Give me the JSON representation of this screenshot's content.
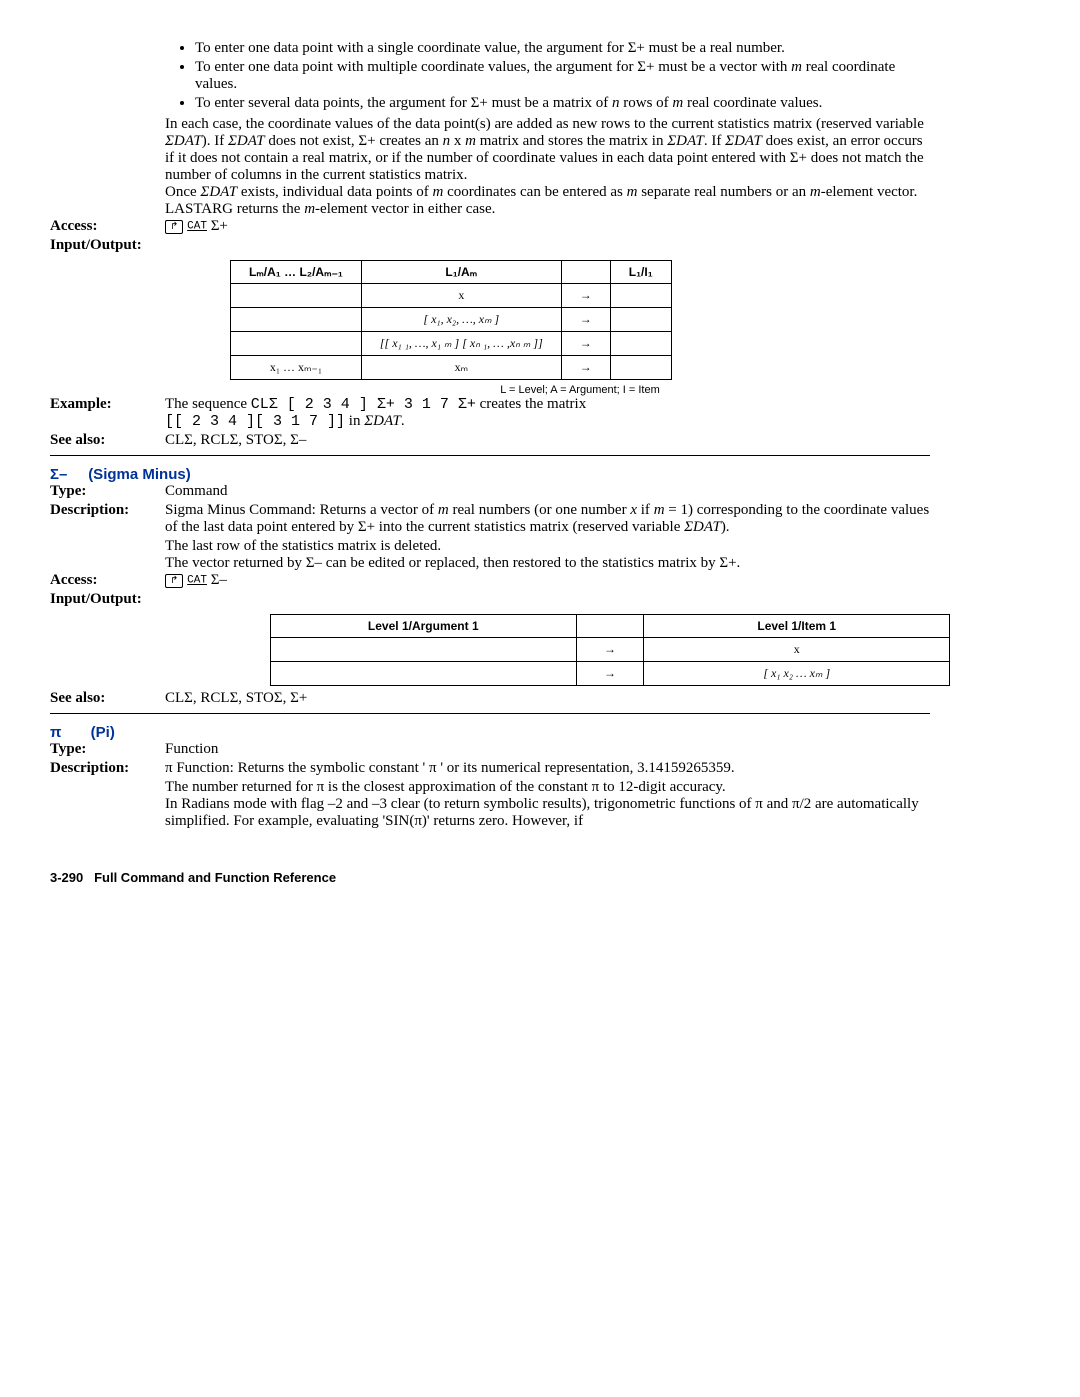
{
  "sigma_plus": {
    "bullets": [
      "To enter one data point with a single coordinate value, the argument for Σ+ must be a real number.",
      "To enter one data point with multiple coordinate values, the argument for Σ+ must be a vector with m real coordinate values.",
      "To enter several data points, the argument for Σ+ must be a matrix of n rows of m real coordinate values."
    ],
    "para1": "In each case, the coordinate values of the data point(s) are added as new rows to the current statistics matrix (reserved variable ΣDAT). If ΣDAT does not exist, Σ+ creates an n x m matrix and stores the matrix in ΣDAT. If ΣDAT does exist, an error occurs if it does not contain a real matrix, or if the number of coordinate values in each data point entered with Σ+ does not match the number of columns in the current statistics matrix.",
    "para2": "Once ΣDAT exists, individual data points of m coordinates can be entered as m separate real numbers or an m-element vector. LASTARG returns the m-element vector in either case.",
    "access_label": "Access:",
    "access_key": "↱",
    "access_cat": "CAT",
    "access_suffix": "Σ+",
    "io_label": "Input/Output:",
    "table": {
      "headers": [
        "Lₘ/A₁ … L₂/Aₘ₋₁",
        "L₁/Aₘ",
        "",
        "L₁/I₁"
      ],
      "rows": [
        [
          "",
          "x",
          "→",
          ""
        ],
        [
          "",
          "[ x₁, x₂, …, xₘ ]",
          "→",
          ""
        ],
        [
          "",
          "[[ x₁ ₁, …, x₁ ₘ ] [ xₙ ₁, … ,xₙ ₘ ]]",
          "→",
          ""
        ],
        [
          "x₁ … xₘ₋₁",
          "xₘ",
          "→",
          ""
        ]
      ],
      "caption": "L = Level; A = Argument; I = Item"
    },
    "example_label": "Example:",
    "example_line1a": "The sequence ",
    "example_line1b": "CLΣ [ 2 3 4 ] Σ+ 3 1 7 Σ+",
    "example_line1c": " creates the matrix",
    "example_line2a": "[[ 2 3 4 ][ 3 1 7 ]]",
    "example_line2b": " in ΣDAT.",
    "seealso_label": "See also:",
    "seealso": "CLΣ, RCLΣ, STOΣ, Σ–"
  },
  "sigma_minus": {
    "title_symbol": "Σ–",
    "title_name": "(Sigma Minus)",
    "type_label": "Type:",
    "type": "Command",
    "desc_label": "Description:",
    "desc1": "Sigma Minus Command: Returns a vector of m real numbers (or one number x if m = 1) corresponding to the coordinate values of the last data point entered by Σ+ into the current statistics matrix (reserved variable ΣDAT).",
    "desc2": "The last row of the statistics matrix is deleted.",
    "desc3": "The vector returned by Σ– can be edited or replaced, then restored to the statistics matrix by Σ+.",
    "access_label": "Access:",
    "access_key": "↱",
    "access_cat": "CAT",
    "access_suffix": "Σ–",
    "io_label": "Input/Output:",
    "table": {
      "headers": [
        "Level 1/Argument 1",
        "",
        "Level 1/Item 1"
      ],
      "rows": [
        [
          "",
          "→",
          "x"
        ],
        [
          "",
          "→",
          "[ x₁ x₂ … xₘ ]"
        ]
      ]
    },
    "seealso_label": "See also:",
    "seealso": "CLΣ, RCLΣ, STOΣ, Σ+"
  },
  "pi": {
    "title_symbol": "π",
    "title_name": "(Pi)",
    "type_label": "Type:",
    "type": "Function",
    "desc_label": "Description:",
    "desc1": "π Function: Returns the symbolic constant ' π ' or its numerical representation, 3.14159265359.",
    "desc2": "The number returned for π is the closest approximation of the constant π to 12-digit accuracy.",
    "desc3": "In Radians mode with flag –2 and –3 clear (to return symbolic results), trigonometric functions of π and π/2 are automatically simplified. For example, evaluating 'SIN(π)' returns zero. However, if"
  },
  "footer": {
    "page": "3-290",
    "title": "Full Command and Function Reference"
  }
}
